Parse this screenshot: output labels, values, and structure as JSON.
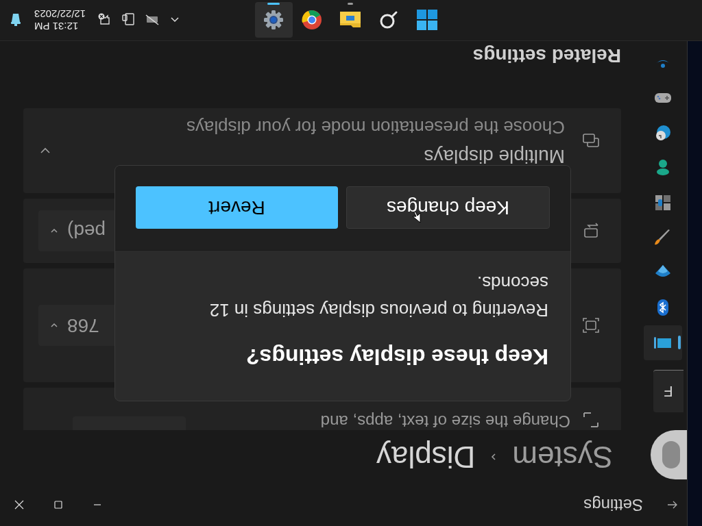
{
  "window": {
    "title": "Settings"
  },
  "breadcrumb": {
    "parent": "System",
    "current": "Display"
  },
  "sidebar": {
    "search_text": "F",
    "items": [
      {
        "kind": "system",
        "selected": true
      },
      {
        "kind": "bluetooth",
        "selected": false
      },
      {
        "kind": "network",
        "selected": false
      },
      {
        "kind": "personalization",
        "selected": false
      },
      {
        "kind": "apps",
        "selected": false
      },
      {
        "kind": "accounts",
        "selected": false
      },
      {
        "kind": "time",
        "selected": false
      },
      {
        "kind": "gaming",
        "selected": false
      },
      {
        "kind": "accessibility",
        "selected": false
      }
    ]
  },
  "cards": [
    {
      "kind": "scale",
      "description": "Change the size of text, apps, and"
    },
    {
      "kind": "resolution",
      "value": "768"
    },
    {
      "kind": "orientation",
      "value": "ped)"
    },
    {
      "kind": "multiple_displays",
      "title": "Multiple displays",
      "description": "Choose the presentation mode for your displays",
      "expanded": false
    }
  ],
  "related_heading": "Related settings",
  "dialog": {
    "title": "Keep these display settings?",
    "message": "Reverting to previous display settings in 12 seconds.",
    "buttons": [
      {
        "label": "Keep changes",
        "primary": false
      },
      {
        "label": "Revert",
        "primary": true
      }
    ]
  },
  "taskbar": {
    "apps": [
      {
        "kind": "start",
        "running": false,
        "active": false
      },
      {
        "kind": "search",
        "running": false,
        "active": false
      },
      {
        "kind": "explorer",
        "running": true,
        "active": false
      },
      {
        "kind": "chrome",
        "running": false,
        "active": false
      },
      {
        "kind": "settings",
        "running": true,
        "active": true
      }
    ],
    "time": "12:31 PM",
    "date": "12/22/2023"
  }
}
